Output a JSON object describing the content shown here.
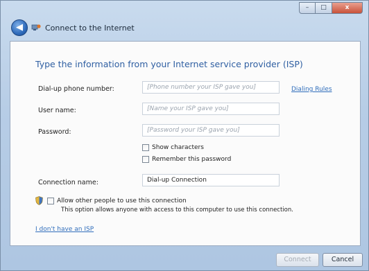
{
  "window": {
    "title": "Connect to the Internet",
    "caption": {
      "minimize": "–",
      "maximize": "□",
      "close": "x"
    }
  },
  "nav": {
    "back_icon": "back-arrow-icon",
    "back_glyph": "◀"
  },
  "colors": {
    "heading": "#2f5fa2",
    "link": "#2f6dbb",
    "frame": "#b7cde6"
  },
  "form": {
    "heading": "Type the information from your Internet service provider (ISP)",
    "phone": {
      "label": "Dial-up phone number:",
      "placeholder": "[Phone number your ISP gave you]"
    },
    "dialing_rules": "Dialing Rules",
    "username": {
      "label": "User name:",
      "placeholder": "[Name your ISP gave you]"
    },
    "password": {
      "label": "Password:",
      "placeholder": "[Password your ISP gave you]"
    },
    "show_characters": "Show characters",
    "remember_password": "Remember this password",
    "connection_name": {
      "label": "Connection name:",
      "value": "Dial-up Connection"
    },
    "allow_others": "Allow other people to use this connection",
    "allow_note": "This option allows anyone with access to this computer to use this connection.",
    "no_isp_link": "I don't have an ISP"
  },
  "buttons": {
    "connect": "Connect",
    "cancel": "Cancel"
  }
}
